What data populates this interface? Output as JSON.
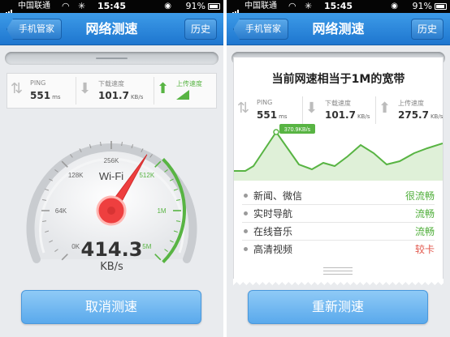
{
  "status_bar": {
    "carrier": "中国联通",
    "time": "15:45",
    "battery": "91%"
  },
  "navbar": {
    "back_label": "手机管家",
    "title": "网络测速",
    "history_label": "历史"
  },
  "left": {
    "ping": {
      "label": "PING",
      "value": "551",
      "unit": "ms"
    },
    "download": {
      "label": "下载速度",
      "value": "101.7",
      "unit": "KB/s"
    },
    "upload": {
      "label": "上传速度"
    },
    "gauge": {
      "ticks": [
        "0K",
        "64K",
        "128K",
        "256K",
        "512K",
        "1M",
        "5M"
      ],
      "network": "Wi-Fi",
      "speed": "414.3",
      "unit": "KB/s",
      "needle_fraction": 0.62
    },
    "cancel_label": "取消测速"
  },
  "right": {
    "headline": "当前网速相当于1M的宽带",
    "ping": {
      "label": "PING",
      "value": "551",
      "unit": "ms"
    },
    "download": {
      "label": "下载速度",
      "value": "101.7",
      "unit": "KB/s"
    },
    "upload": {
      "label": "上传速度",
      "value": "275.7",
      "unit": "KB/s"
    },
    "peak_label": "370.9KB/s",
    "rows": [
      {
        "name": "新闻、微信",
        "status": "很流畅",
        "color": "#4fae3a"
      },
      {
        "name": "实时导航",
        "status": "流畅",
        "color": "#4fae3a"
      },
      {
        "name": "在线音乐",
        "status": "流畅",
        "color": "#4fae3a"
      },
      {
        "name": "高清视频",
        "status": "较卡",
        "color": "#e2574c"
      }
    ],
    "retest_label": "重新测速"
  },
  "colors": {
    "nav": "#2a86dc",
    "green": "#58b443",
    "needle": "#ee3f3f",
    "button": "#6db5f0"
  }
}
